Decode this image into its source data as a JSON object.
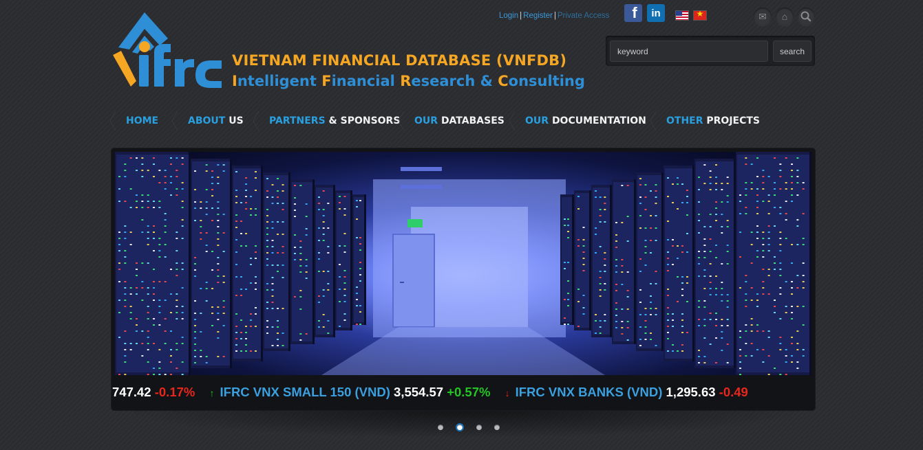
{
  "brand": {
    "logo_text": "ifrc",
    "line1": "VIETNAM FINANCIAL DATABASE (VNFDB)",
    "line2_parts": [
      {
        "initial": "I",
        "rest": "ntelligent "
      },
      {
        "initial": "F",
        "rest": "inancial "
      },
      {
        "initial": "R",
        "rest": "esearch & "
      },
      {
        "initial": "C",
        "rest": "onsulting"
      }
    ],
    "colors": {
      "orange": "#f5a623",
      "blue": "#2f8fd6"
    }
  },
  "toplinks": {
    "login": "Login",
    "register": "Register",
    "private": "Private Access",
    "separator": "|"
  },
  "social": {
    "facebook_icon": "facebook-icon",
    "facebook_glyph": "f",
    "linkedin_icon": "linkedin-icon",
    "linkedin_glyph": "in"
  },
  "languages": [
    {
      "icon": "us-flag-icon"
    },
    {
      "icon": "vn-flag-icon",
      "star": "★"
    }
  ],
  "utility_icons": {
    "mail": "✉",
    "home": "⌂",
    "search": "⚲"
  },
  "search": {
    "placeholder": "keyword",
    "button": "search"
  },
  "nav": [
    {
      "a": "HOME",
      "b": ""
    },
    {
      "a": "ABOUT ",
      "b": "US"
    },
    {
      "a": "PARTNERS ",
      "b": "& SPONSORS"
    },
    {
      "a": "OUR ",
      "b": "DATABASES"
    },
    {
      "a": "OUR ",
      "b": "DOCUMENTATION"
    },
    {
      "a": "OTHER ",
      "b": "PROJECTS"
    }
  ],
  "ticker": {
    "first_value": "747.42",
    "first_change": "-0.17%",
    "items": [
      {
        "name": "IFRC VNX SMALL 150 (VND)",
        "value": "3,554.57",
        "change": "+0.57%",
        "direction": "up",
        "arrow": "↑"
      },
      {
        "name": "IFRC VNX BANKS (VND)",
        "value": "1,295.63",
        "change": "-0.49",
        "direction": "down",
        "arrow": "↓"
      }
    ]
  },
  "slider": {
    "image": "server-room-image",
    "exit_sign": "exit",
    "dots": 4,
    "active_dot": 2
  }
}
